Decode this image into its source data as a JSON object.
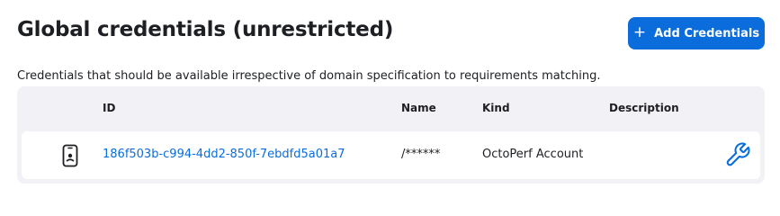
{
  "header": {
    "title": "Global credentials (unrestricted)",
    "add_button_icon": "plus-icon",
    "add_button_label": "Add Credentials",
    "description": "Credentials that should be available irrespective of domain specification to requirements matching."
  },
  "table": {
    "columns": [
      "ID",
      "Name",
      "Kind",
      "Description"
    ],
    "rows": [
      {
        "icon": "mobile-device-icon",
        "id": "186f503b-c994-4dd2-850f-7ebdfd5a01a7",
        "name": "/******",
        "kind": "OctoPerf Account",
        "description": "",
        "action_icon": "wrench-icon"
      }
    ]
  },
  "colors": {
    "accent": "#0b6cdb",
    "table_background": "#f2f2f6",
    "text": "#1d1f23"
  }
}
